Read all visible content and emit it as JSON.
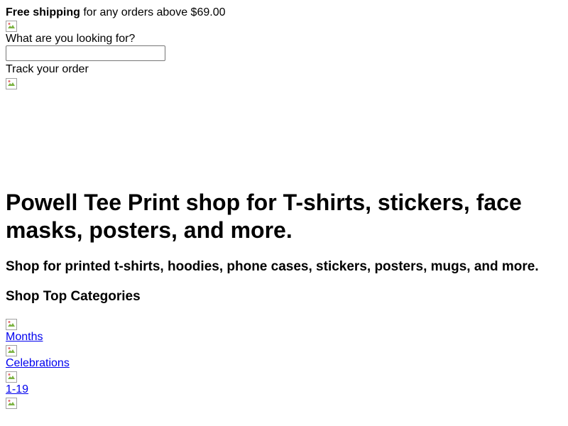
{
  "topbar": {
    "shipping_bold": "Free shipping",
    "shipping_rest": " for any orders above $69.00"
  },
  "search": {
    "label": "What are you looking for?",
    "value": "",
    "placeholder": ""
  },
  "track_order": "Track your order",
  "hero": {
    "title": "Powell Tee Print shop for T-shirts, stickers, face masks, posters, and more.",
    "subtitle": "Shop for printed t-shirts, hoodies, phone cases, stickers, posters, mugs, and more."
  },
  "categories": {
    "heading": "Shop Top Categories",
    "items": [
      {
        "label": "Months"
      },
      {
        "label": "Celebrations"
      },
      {
        "label": "1-19"
      }
    ]
  },
  "icons": {
    "broken_image": "broken-image-icon"
  }
}
